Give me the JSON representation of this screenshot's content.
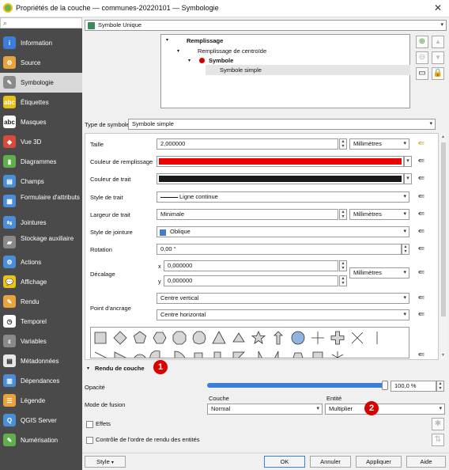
{
  "window": {
    "title": "Propriétés de la couche — communes-20220101 — Symbologie",
    "close": "✕"
  },
  "search": {
    "placeholder": ""
  },
  "sidebar": {
    "items": [
      {
        "label": "Information",
        "icon": "info-icon",
        "color": "#3b7dd8",
        "glyph": "i"
      },
      {
        "label": "Source",
        "icon": "source-icon",
        "color": "#e8a33d",
        "glyph": "⚙"
      },
      {
        "label": "Symbologie",
        "icon": "symbology-icon",
        "color": "#8a8a8a",
        "glyph": "✎"
      },
      {
        "label": "Étiquettes",
        "icon": "labels-icon",
        "color": "#e8c21a",
        "glyph": "abc"
      },
      {
        "label": "Masques",
        "icon": "masks-icon",
        "color": "#ffffff",
        "glyph": "abc"
      },
      {
        "label": "Vue 3D",
        "icon": "3d-view-icon",
        "color": "#d84a3a",
        "glyph": "◆"
      },
      {
        "label": "Diagrammes",
        "icon": "diagrams-icon",
        "color": "#5fae4a",
        "glyph": "▮"
      },
      {
        "label": "Champs",
        "icon": "fields-icon",
        "color": "#4a8ed8",
        "glyph": "▤"
      },
      {
        "label": "Formulaire d'attributs",
        "icon": "attribute-form-icon",
        "color": "#4a8ed8",
        "glyph": "▦"
      },
      {
        "label": "Jointures",
        "icon": "joins-icon",
        "color": "#4a8ed8",
        "glyph": "⇆"
      },
      {
        "label": "Stockage auxiliaire",
        "icon": "auxiliary-storage-icon",
        "color": "#8a8a8a",
        "glyph": "▰"
      },
      {
        "label": "Actions",
        "icon": "actions-icon",
        "color": "#4a8ed8",
        "glyph": "⚙"
      },
      {
        "label": "Affichage",
        "icon": "display-icon",
        "color": "#e8c21a",
        "glyph": "💬"
      },
      {
        "label": "Rendu",
        "icon": "rendering-icon",
        "color": "#e8a33d",
        "glyph": "✎"
      },
      {
        "label": "Temporel",
        "icon": "temporal-icon",
        "color": "#ffffff",
        "glyph": "◷"
      },
      {
        "label": "Variables",
        "icon": "variables-icon",
        "color": "#8a8a8a",
        "glyph": "ε"
      },
      {
        "label": "Métadonnées",
        "icon": "metadata-icon",
        "color": "#e8e8e8",
        "glyph": "▤"
      },
      {
        "label": "Dépendances",
        "icon": "dependencies-icon",
        "color": "#4a8ed8",
        "glyph": "▥"
      },
      {
        "label": "Légende",
        "icon": "legend-icon",
        "color": "#e8a33d",
        "glyph": "☰"
      },
      {
        "label": "QGIS Server",
        "icon": "qgis-server-icon",
        "color": "#4a8ed8",
        "glyph": "Q"
      },
      {
        "label": "Numérisation",
        "icon": "digitizing-icon",
        "color": "#5fae4a",
        "glyph": "✎"
      }
    ]
  },
  "renderer": {
    "label": "Symbole Unique"
  },
  "tree": {
    "fill": "Remplissage",
    "centroid": "Remplissage de centroïde",
    "symbol": "Symbole",
    "simple": "Symbole simple"
  },
  "symbol_type": {
    "label": "Type de symbole",
    "value": "Symbole simple"
  },
  "props": {
    "size_label": "Taille",
    "size_value": "2,000000",
    "size_unit": "Millimètres",
    "fill_color_label": "Couleur de remplissage",
    "fill_color": "#ee0000",
    "stroke_color_label": "Couleur de trait",
    "stroke_color": "#1a1a1a",
    "stroke_style_label": "Style de trait",
    "stroke_style_value": "Ligne continue",
    "stroke_width_label": "Largeur de trait",
    "stroke_width_value": "Minimale",
    "stroke_width_unit": "Millimètres",
    "join_style_label": "Style de jointure",
    "join_style_value": "Oblique",
    "rotation_label": "Rotation",
    "rotation_value": "0,00 °",
    "offset_label": "Décalage",
    "offset_x_label": "x",
    "offset_x": "0,000000",
    "offset_y_label": "y",
    "offset_y": "0,000000",
    "offset_unit": "Millimètres",
    "anchor_label": "Point d'ancrage",
    "anchor_v": "Centre vertical",
    "anchor_h": "Centre horizontal"
  },
  "shapes": {
    "row1": [
      "square",
      "diamond",
      "pentagon",
      "hexagon",
      "octagon",
      "decagon",
      "triangle",
      "equilateral-triangle",
      "star",
      "arrow",
      "circle",
      "cross",
      "cross-fill",
      "x-cross",
      "line"
    ],
    "row2": [
      "arrowhead",
      "filled-arrowhead",
      "semicircle",
      "third-circle",
      "quarter-circle",
      "quarter-square",
      "half-square",
      "diagonal-half-square",
      "right-half-triangle",
      "left-half-triangle",
      "trapezoid",
      "shield",
      "asterisk"
    ]
  },
  "layer_render": {
    "title": "Rendu de couche",
    "opacity_label": "Opacité",
    "opacity_value": "100,0 %",
    "opacity": 1.0,
    "blend_label": "Mode de fusion",
    "layer_label": "Couche",
    "layer_value": "Normal",
    "feature_label": "Entité",
    "feature_value": "Multiplier",
    "effects_label": "Effets",
    "order_label": "Contrôle de l'ordre de rendu des entités"
  },
  "badges": {
    "one": "1",
    "two": "2"
  },
  "footer": {
    "style": "Style",
    "ok": "OK",
    "cancel": "Annuler",
    "apply": "Appliquer",
    "help": "Aide"
  }
}
